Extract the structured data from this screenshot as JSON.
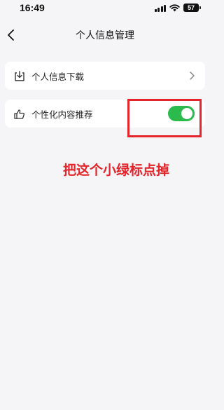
{
  "status_bar": {
    "time": "16:49",
    "battery": "57"
  },
  "header": {
    "title": "个人信息管理"
  },
  "settings": {
    "items": [
      {
        "label": "个人信息下载",
        "icon": "download-icon",
        "control": "chevron"
      },
      {
        "label": "个性化内容推荐",
        "icon": "thumbs-up-icon",
        "control": "toggle",
        "toggle_on": true
      }
    ]
  },
  "annotation": {
    "text": "把这个小绿标点掉",
    "color": "#e3252b"
  },
  "colors": {
    "toggle_on": "#2bba4c",
    "background": "#f5f5f7",
    "annotation_red": "#e3252b"
  }
}
